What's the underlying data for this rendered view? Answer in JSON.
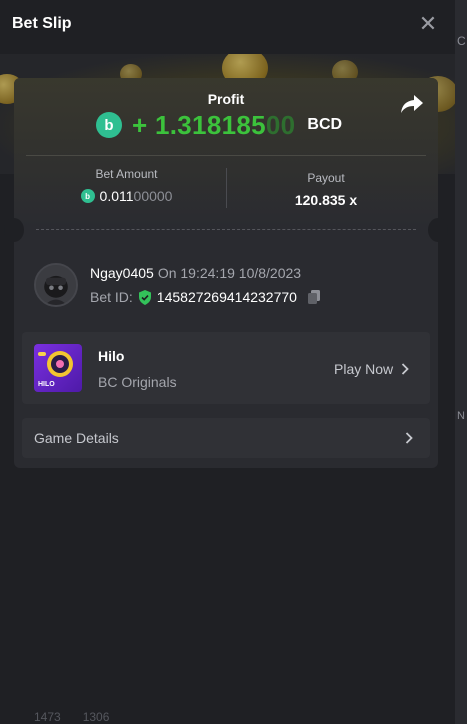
{
  "header": {
    "title": "Bet Slip",
    "close_glyph": "✕"
  },
  "profit": {
    "label": "Profit",
    "sign": "+ ",
    "value_main": "1.318185",
    "value_dim": "00",
    "currency": "BCD",
    "coin_glyph": "b"
  },
  "bet_amount": {
    "label": "Bet Amount",
    "value_main": "0.011",
    "value_dim": "00000"
  },
  "payout": {
    "label": "Payout",
    "value": "120.835 x"
  },
  "user": {
    "name": "Ngay0405",
    "on_text": "On 19:24:19 10/8/2023",
    "bet_id_label": "Bet ID:",
    "bet_id": "145827269414232770"
  },
  "game": {
    "name": "Hilo",
    "provider": "BC Originals",
    "thumb_text": "HILO",
    "play_label": "Play Now"
  },
  "details": {
    "label": "Game Details"
  },
  "background": {
    "right_fragment_top": "C",
    "right_fragment_mid": "N",
    "bottom_count_1": "1473",
    "bottom_count_2": "1306"
  },
  "colors": {
    "accent_green": "#3cc23c",
    "coin_teal": "#2fbf91",
    "game_purple": "#7a2fe0"
  }
}
